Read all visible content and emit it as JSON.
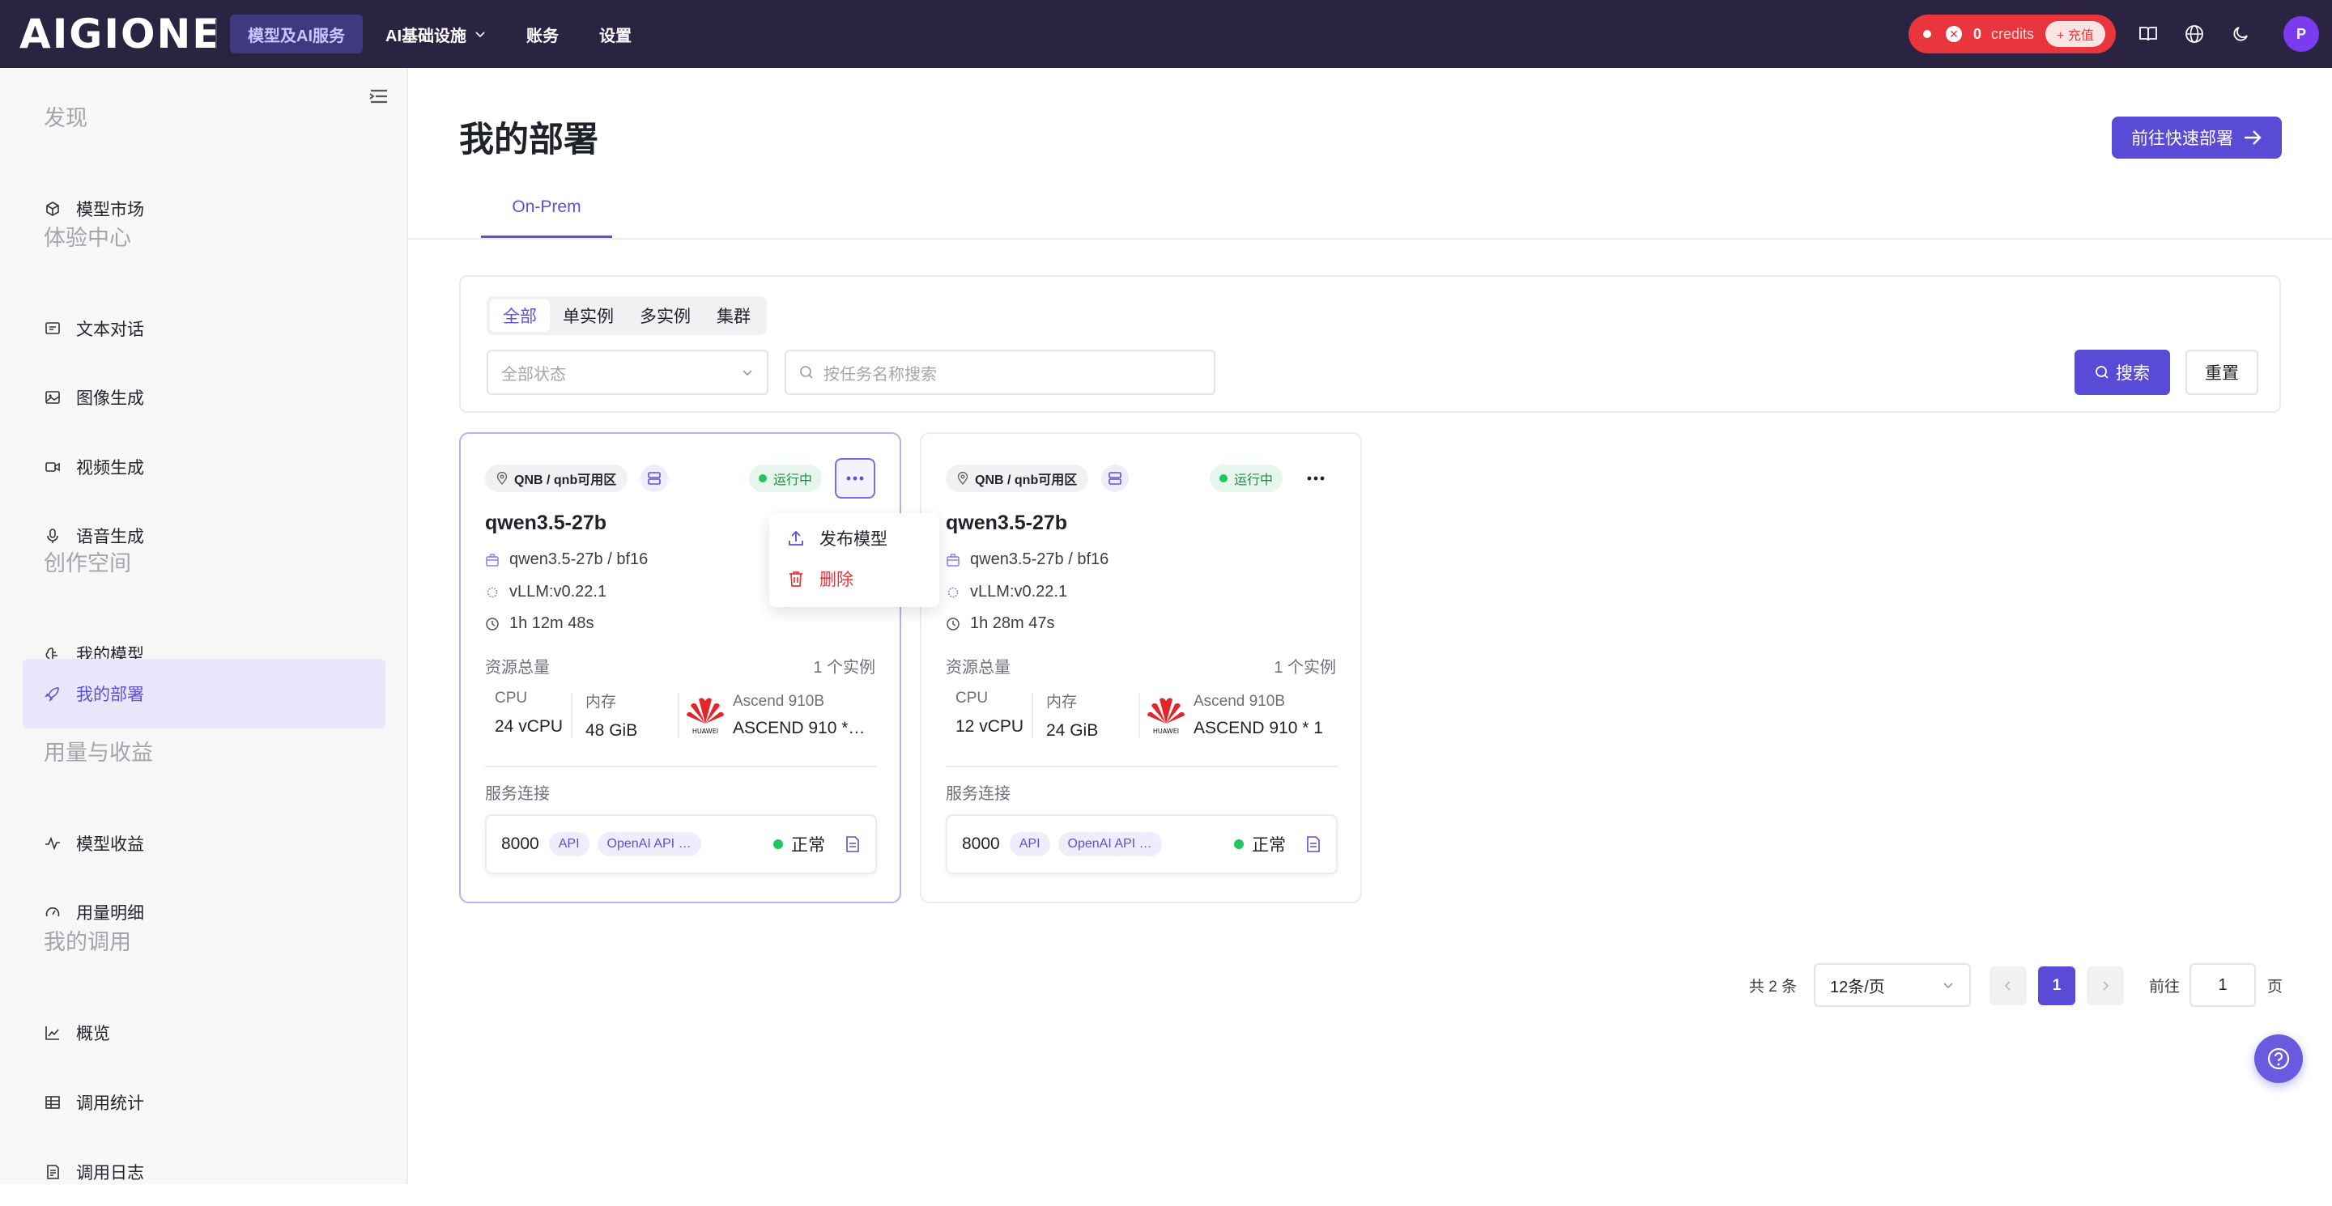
{
  "header": {
    "logo_text": "AIGIONE",
    "nav": [
      {
        "label": "模型及AI服务",
        "active": true
      },
      {
        "label": "AI基础设施",
        "dropdown": true
      },
      {
        "label": "账务"
      },
      {
        "label": "设置"
      }
    ],
    "credits": {
      "value": "0",
      "label": "credits",
      "recharge_label": "+ 充值"
    },
    "avatar_initial": "P"
  },
  "sidebar": {
    "sections": [
      {
        "title": "发现",
        "items": [
          {
            "label": "模型市场",
            "icon": "cube-icon"
          }
        ]
      },
      {
        "title": "体验中心",
        "items": [
          {
            "label": "文本对话",
            "icon": "chat-icon"
          },
          {
            "label": "图像生成",
            "icon": "image-icon"
          },
          {
            "label": "视频生成",
            "icon": "video-icon"
          },
          {
            "label": "语音生成",
            "icon": "mic-icon"
          }
        ]
      },
      {
        "title": "创作空间",
        "items": [
          {
            "label": "我的模型",
            "icon": "brain-icon"
          },
          {
            "label": "我的部署",
            "icon": "rocket-icon",
            "active": true
          }
        ]
      },
      {
        "title": "用量与收益",
        "items": [
          {
            "label": "模型收益",
            "icon": "pulse-icon"
          },
          {
            "label": "用量明细",
            "icon": "gauge-icon"
          }
        ]
      },
      {
        "title": "我的调用",
        "items": [
          {
            "label": "概览",
            "icon": "chart-icon"
          },
          {
            "label": "调用统计",
            "icon": "table-icon"
          },
          {
            "label": "调用日志",
            "icon": "log-icon"
          }
        ]
      }
    ]
  },
  "main": {
    "title": "我的部署",
    "quick_deploy_label": "前往快速部署",
    "tab": "On-Prem",
    "filter": {
      "segments": [
        "全部",
        "单实例",
        "多实例",
        "集群"
      ],
      "active_segment": "全部",
      "status_placeholder": "全部状态",
      "search_placeholder": "按任务名称搜索",
      "search_label": "搜索",
      "reset_label": "重置"
    },
    "cards": [
      {
        "zone": "QNB / qnb可用区",
        "status": "运行中",
        "name": "qwen3.5-27b",
        "model": "qwen3.5-27b / bf16",
        "engine": "vLLM:v0.22.1",
        "uptime": "1h 12m 48s",
        "resources_label": "资源总量",
        "instances": "1 个实例",
        "cpu_label": "CPU",
        "cpu": "24 vCPU",
        "mem_label": "内存",
        "mem": "48 GiB",
        "accel_label": "Ascend 910B",
        "accel": "ASCEND 910 *…",
        "conn_label": "服务连接",
        "port": "8000",
        "api_tag": "API",
        "api_type": "OpenAI API …",
        "conn_status": "正常"
      },
      {
        "zone": "QNB / qnb可用区",
        "status": "运行中",
        "name": "qwen3.5-27b",
        "model": "qwen3.5-27b / bf16",
        "engine": "vLLM:v0.22.1",
        "uptime": "1h 28m 47s",
        "resources_label": "资源总量",
        "instances": "1 个实例",
        "cpu_label": "CPU",
        "cpu": "12 vCPU",
        "mem_label": "内存",
        "mem": "24 GiB",
        "accel_label": "Ascend 910B",
        "accel": "ASCEND 910 * 1",
        "conn_label": "服务连接",
        "port": "8000",
        "api_tag": "API",
        "api_type": "OpenAI API …",
        "conn_status": "正常"
      }
    ],
    "menu": [
      {
        "label": "发布模型",
        "icon": "upload-icon"
      },
      {
        "label": "删除",
        "icon": "trash-icon",
        "color": "#e8363c"
      }
    ],
    "pagination": {
      "total": "共 2 条",
      "page_size": "12条/页",
      "current_page": "1",
      "goto_label": "前往",
      "goto_value": "1",
      "page_unit": "页"
    }
  },
  "colors": {
    "accent": "#5a4bd6",
    "danger": "#e8363c",
    "topbar": "#2a2342",
    "success": "#22c55e"
  }
}
